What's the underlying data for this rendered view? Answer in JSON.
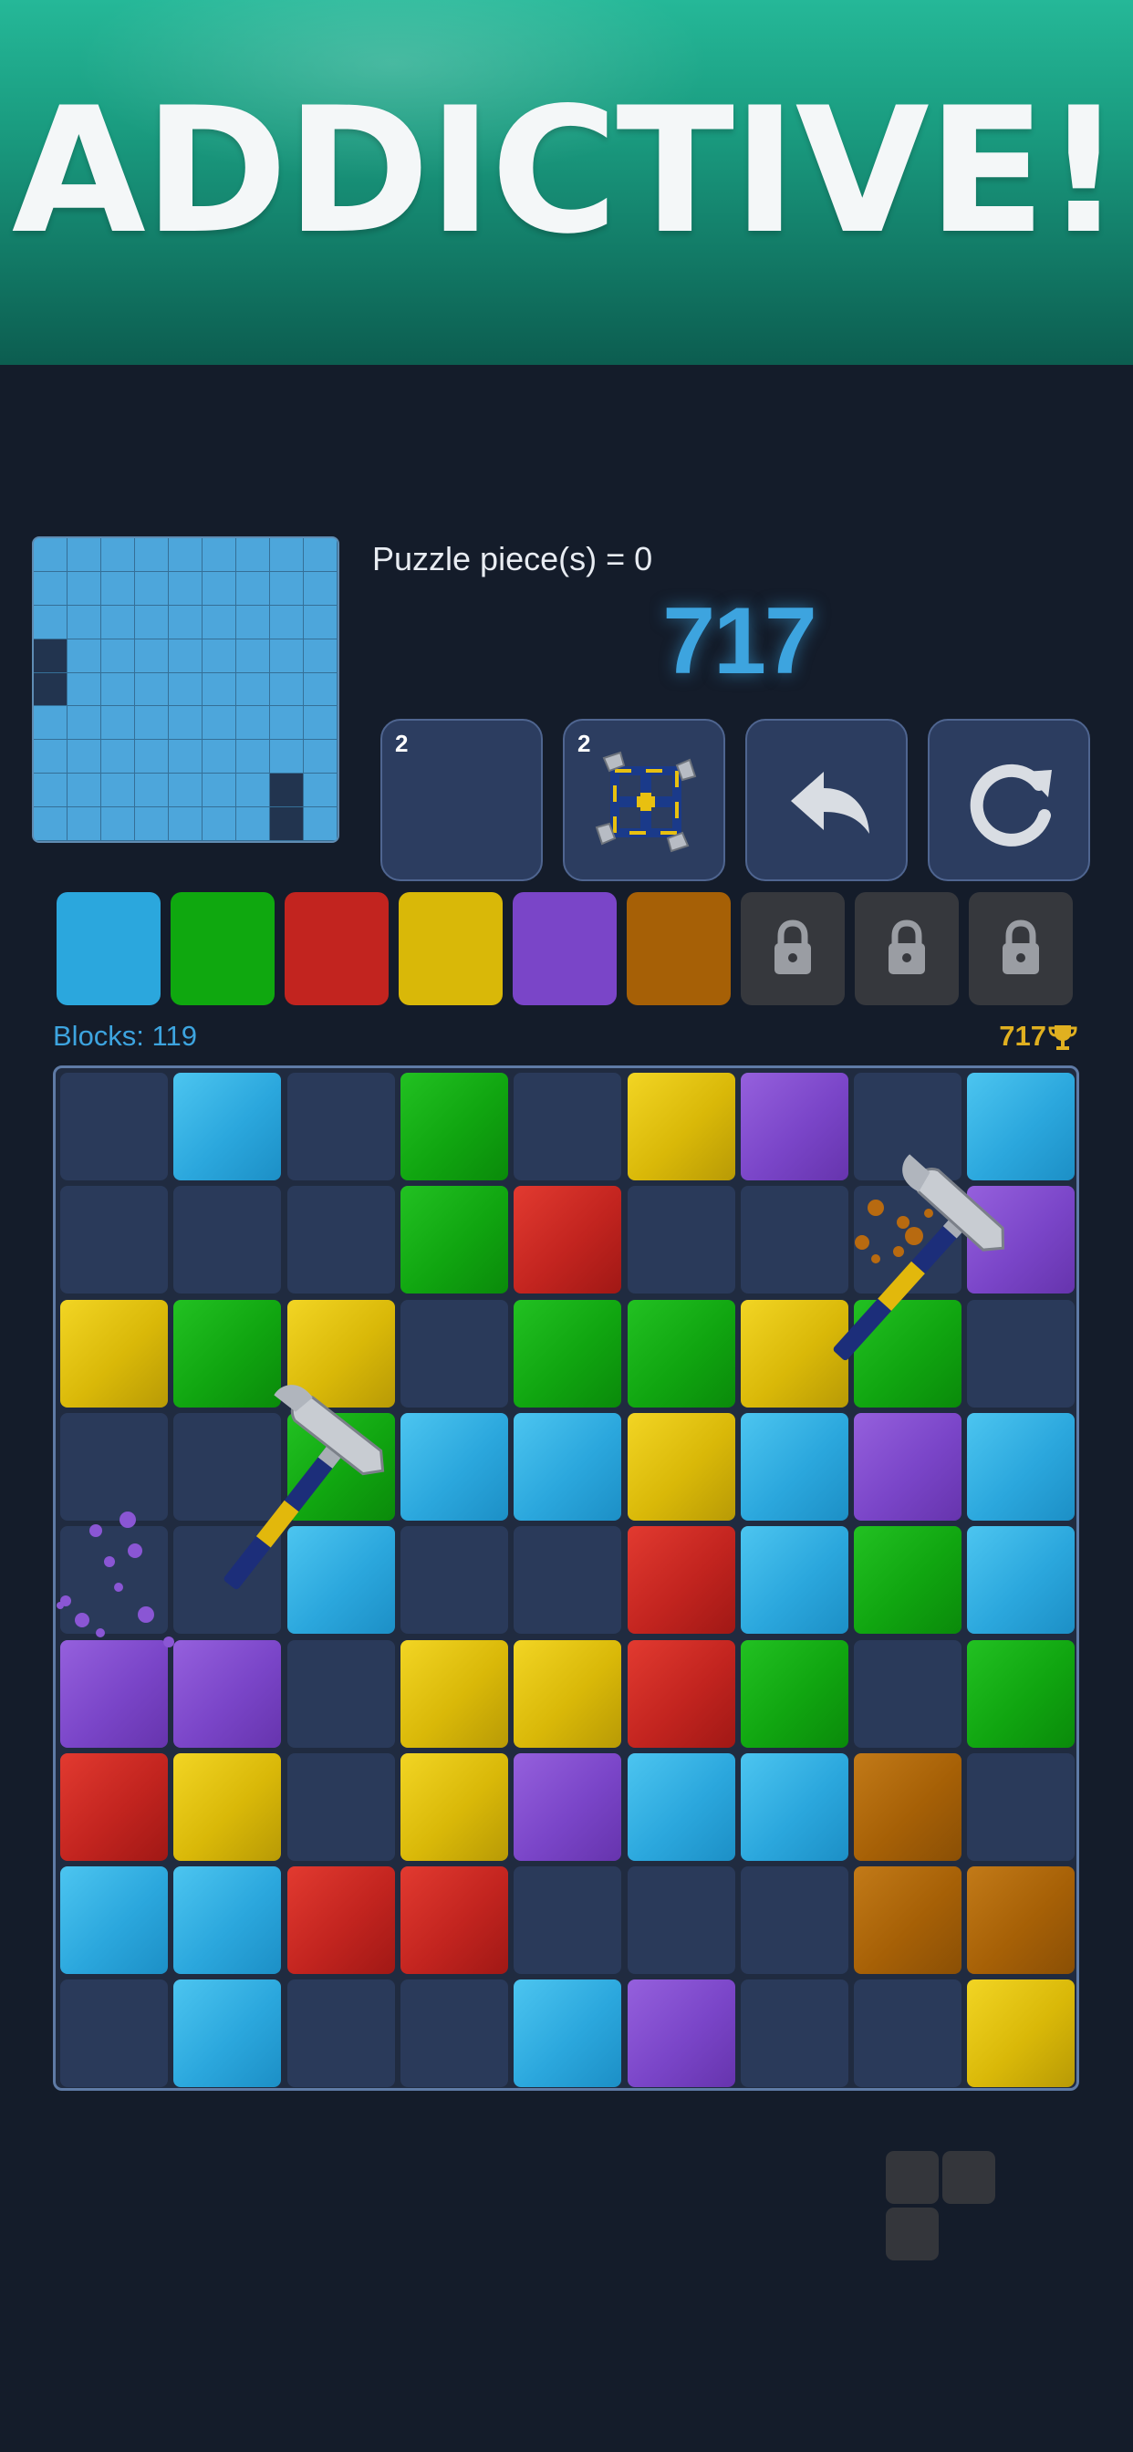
{
  "banner": {
    "title": "ADDICTIVE!"
  },
  "mini_board": {
    "rows": [
      "EEEEEEEEE",
      "EEEEEEEEE",
      "EEEEEEEEE",
      "XEEEEEEEE",
      "XEEEEEEEE",
      "EEEEEEEEE",
      "EEEEEEEEE",
      "EEEEEEEXE",
      "EEEEEEEXE"
    ]
  },
  "puzzle_label": "Puzzle piece(s) = 0",
  "score": "717",
  "tools": [
    {
      "name": "empty-tool",
      "count": "2",
      "icon": "none"
    },
    {
      "name": "hammers-tool",
      "count": "2",
      "icon": "four-hammers-icon"
    },
    {
      "name": "undo-tool",
      "count": "",
      "icon": "undo-arrow-icon"
    },
    {
      "name": "restart-tool",
      "count": "",
      "icon": "restart-icon"
    }
  ],
  "palette": [
    {
      "color": "#2ba7dd",
      "locked": false
    },
    {
      "color": "#0fa80f",
      "locked": false
    },
    {
      "color": "#c2241f",
      "locked": false
    },
    {
      "color": "#d9b808",
      "locked": false
    },
    {
      "color": "#7a45c8",
      "locked": false
    },
    {
      "color": "#a66006",
      "locked": false
    },
    {
      "color": "#36383d",
      "locked": true,
      "icon": "lock-icon"
    },
    {
      "color": "#36383d",
      "locked": true,
      "icon": "lock-icon"
    },
    {
      "color": "#36383d",
      "locked": true,
      "icon": "lock-icon"
    }
  ],
  "blocks_label": "Blocks: 119",
  "best_score": "717",
  "board": {
    "rows": [
      "EBEGEYPEB",
      "EEEGREEEP",
      "YGYEGGYGE",
      "EEGBBYBPB",
      "EEBEERBGB",
      "PPEYYRGEG",
      "RYEYPBBOE",
      "BBRRE EEOO",
      "EBEEBPEEY"
    ],
    "legend": {
      "E": "empty",
      "B": "blue",
      "G": "green",
      "R": "red",
      "Y": "yellow",
      "P": "purple",
      "O": "orange"
    }
  },
  "next_piece": {
    "shape": "L-tromino",
    "icon": "next-piece-icon"
  },
  "colors": {
    "accent": "#3da4df",
    "gold": "#e0b020",
    "background": "#141c2a"
  }
}
